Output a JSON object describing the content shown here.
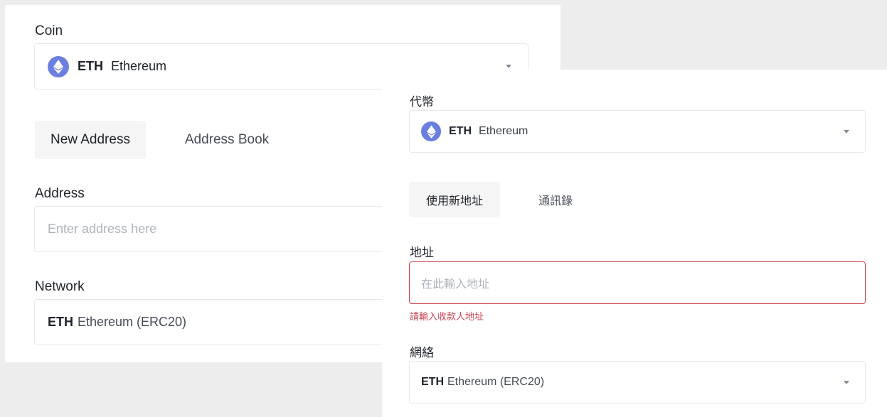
{
  "en": {
    "coin_label": "Coin",
    "coin": {
      "symbol": "ETH",
      "name": "Ethereum"
    },
    "tabs": [
      {
        "label": "New Address",
        "active": true
      },
      {
        "label": "Address Book",
        "active": false
      }
    ],
    "address_label": "Address",
    "address_placeholder": "Enter address here",
    "network_label": "Network",
    "network": {
      "symbol": "ETH",
      "name": "Ethereum (ERC20)"
    }
  },
  "zh": {
    "coin_label": "代幣",
    "coin": {
      "symbol": "ETH",
      "name": "Ethereum"
    },
    "tabs": [
      {
        "label": "使用新地址",
        "active": true
      },
      {
        "label": "通訊錄",
        "active": false
      }
    ],
    "address_label": "地址",
    "address_placeholder": "在此輸入地址",
    "address_error": "請輸入收款人地址",
    "network_label": "網絡",
    "network": {
      "symbol": "ETH",
      "name": "Ethereum (ERC20)"
    }
  },
  "colors": {
    "page_background": "#ededed",
    "panel_background": "#ffffff",
    "eth_icon": "#6b7fe0",
    "error": "#c9434f",
    "active_tab_background": "#f5f5f5"
  },
  "icons": {
    "coin": "ethereum-icon",
    "dropdown": "chevron-down-icon"
  }
}
